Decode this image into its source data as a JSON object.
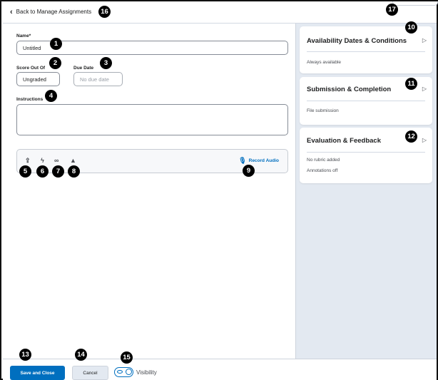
{
  "header": {
    "back_label": "Back to Manage Assignments"
  },
  "form": {
    "name_label": "Name*",
    "name_value": "Untitled",
    "score_label": "Score Out Of",
    "score_value": "Ungraded",
    "due_label": "Due Date",
    "due_placeholder": "No due date",
    "instructions_label": "Instructions",
    "toolbar_icons": [
      "upload-icon",
      "insert-stuff-icon",
      "link-icon",
      "google-drive-icon"
    ],
    "record_audio_label": "Record Audio"
  },
  "sidebar": {
    "cards": [
      {
        "title": "Availability Dates & Conditions",
        "lines": [
          "Always available"
        ]
      },
      {
        "title": "Submission & Completion",
        "lines": [
          "File submission"
        ]
      },
      {
        "title": "Evaluation & Feedback",
        "lines": [
          "No rubric added",
          "Annotations off"
        ]
      }
    ]
  },
  "footer": {
    "save_label": "Save and Close",
    "cancel_label": "Cancel",
    "visibility_label": "Visibility"
  },
  "badges": [
    "1",
    "2",
    "3",
    "4",
    "5",
    "6",
    "7",
    "8",
    "9",
    "10",
    "11",
    "12",
    "13",
    "14",
    "15",
    "16",
    "17"
  ],
  "colors": {
    "accent": "#006fbf",
    "sidebar_bg": "#e3e9f1",
    "badge": "#000000"
  }
}
